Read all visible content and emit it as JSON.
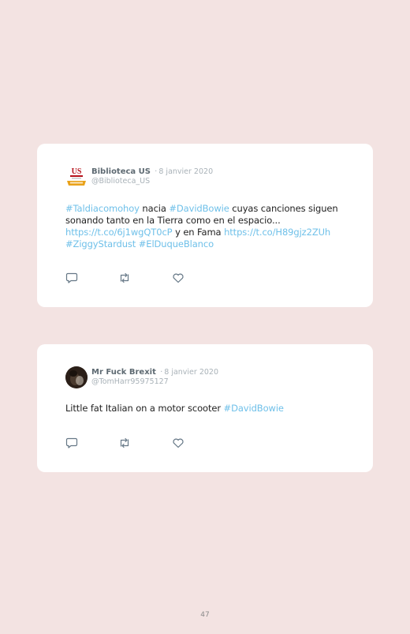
{
  "tweets": [
    {
      "author": "Biblioteca US",
      "date": "8 janvier 2020",
      "handle": "@Biblioteca_US",
      "avatar": {
        "text": "US"
      },
      "body": {
        "tag1": "#Taldiacomohoy",
        "t1": " nacia ",
        "tag2": "#DavidBowie",
        "t2": " cuyas canciones siguen sonando tanto en la Tierra como en el espacio... ",
        "link1": "https://t.co/6j1wgQT0cP",
        "t3": " y en Fama ",
        "link2": "https://t.co/H89gjz2ZUh",
        "tag3": "#ZiggyStardust",
        "tag4": "#ElDuqueBlanco"
      }
    },
    {
      "author": "Mr Fuck Brexit",
      "date": "8 janvier 2020",
      "handle": "@TomHarr95975127",
      "body": {
        "t1": "Little fat Italian on a motor scooter ",
        "tag1": "#DavidBowie"
      }
    }
  ],
  "separator": "·",
  "page_number": "47",
  "icons": [
    "reply-icon",
    "retweet-icon",
    "like-icon"
  ],
  "colors": {
    "background": "#f3e3e2",
    "link": "#6fc0e9",
    "card": "#ffffff"
  }
}
